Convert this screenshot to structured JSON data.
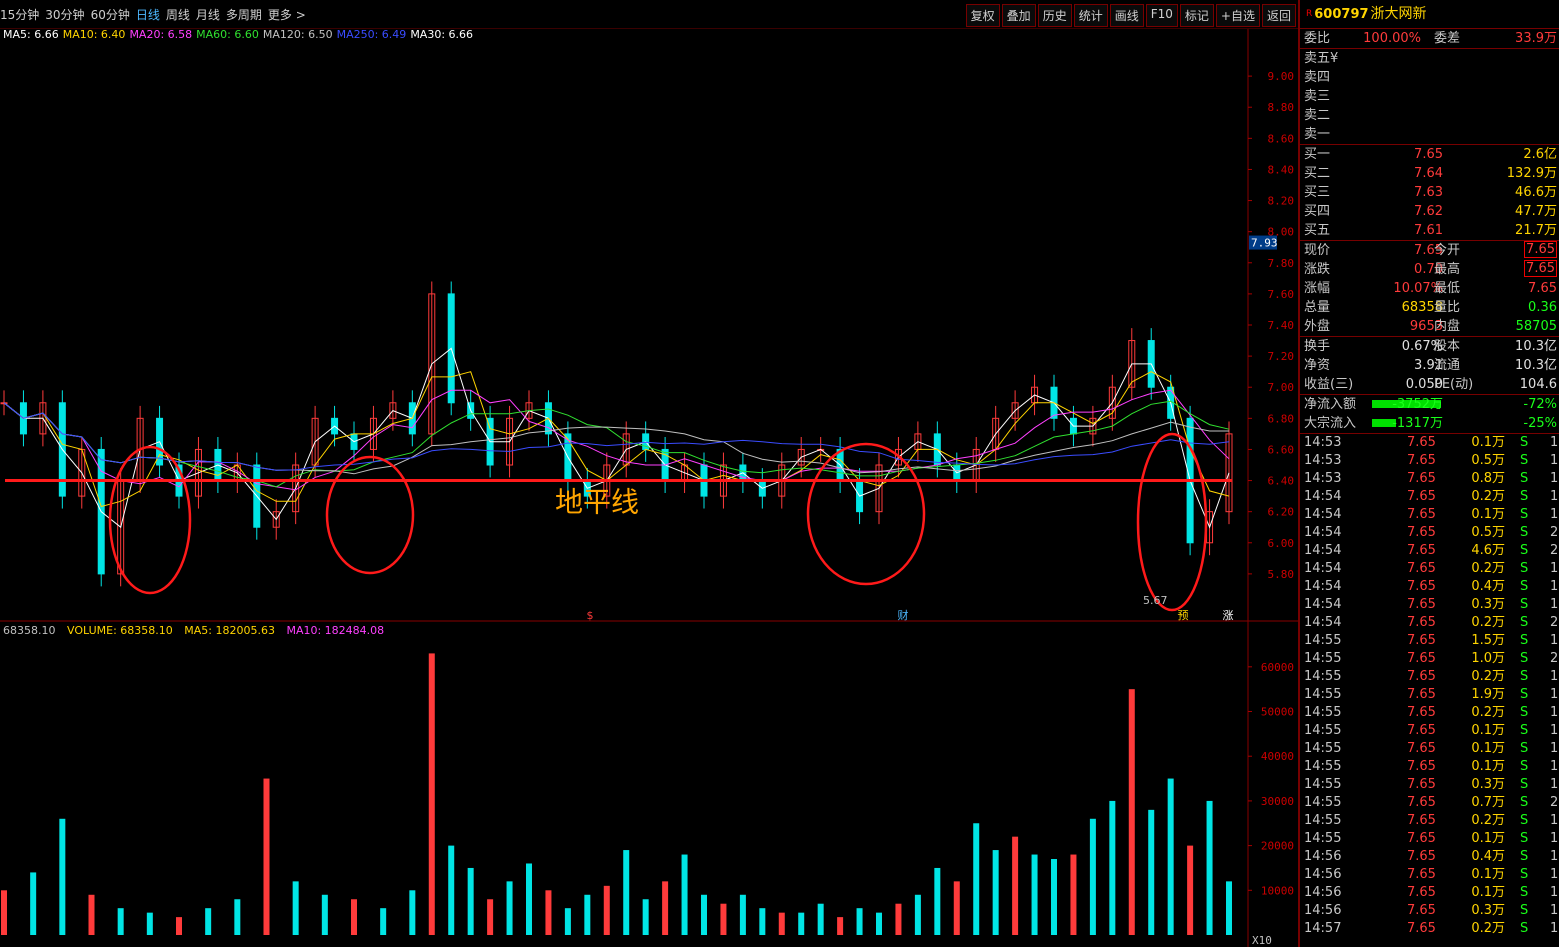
{
  "toolbar": {
    "periods": [
      "15分钟",
      "30分钟",
      "60分钟",
      "日线",
      "周线",
      "月线",
      "多周期",
      "更多"
    ],
    "active_period": "日线",
    "buttons": [
      "复权",
      "叠加",
      "历史",
      "统计",
      "画线",
      "F10",
      "标记",
      "+自选",
      "返回"
    ]
  },
  "ma_legend": [
    {
      "label": "MA5: 6.66",
      "color": "#ffffff"
    },
    {
      "label": "MA10: 6.40",
      "color": "#ffd400"
    },
    {
      "label": "MA20: 6.58",
      "color": "#ff40ff"
    },
    {
      "label": "MA60: 6.60",
      "color": "#30e030"
    },
    {
      "label": "MA120: 6.50",
      "color": "#c0c0c0"
    },
    {
      "label": "MA250: 6.49",
      "color": "#3a4cff"
    },
    {
      "label": "MA30: 6.66",
      "color": "#ffffff"
    }
  ],
  "vol_legend": {
    "left": "68358.10",
    "volume": "VOLUME: 68358.10",
    "ma5": "MA5: 182005.63",
    "ma10": "MA10: 182484.08"
  },
  "chart_data": {
    "type": "candlestick",
    "price_axis": {
      "ticks": [
        "9.00",
        "8.80",
        "8.60",
        "8.40",
        "8.20",
        "8.00",
        "7.80",
        "7.60",
        "7.40",
        "7.20",
        "7.00",
        "6.80",
        "6.60",
        "6.40",
        "6.20",
        "6.00",
        "5.80"
      ],
      "range": [
        5.6,
        9.2
      ]
    },
    "volume_axis": {
      "ticks": [
        "60000",
        "50000",
        "40000",
        "30000",
        "20000",
        "10000"
      ],
      "range": [
        0,
        66000
      ],
      "unit_label": "X10"
    },
    "current_price_tag": "7.93",
    "low_marker": "5.67",
    "horizon_label": "地平线",
    "horizon_price": 6.4,
    "event_markers": [
      "$",
      "财",
      "预",
      "涨"
    ],
    "price_polyline": [
      [
        0,
        6.9
      ],
      [
        10,
        6.7
      ],
      [
        20,
        6.9
      ],
      [
        30,
        6.3
      ],
      [
        40,
        6.6
      ],
      [
        50,
        5.8
      ],
      [
        60,
        6.4
      ],
      [
        70,
        6.8
      ],
      [
        80,
        6.5
      ],
      [
        90,
        6.3
      ],
      [
        100,
        6.6
      ],
      [
        110,
        6.4
      ],
      [
        120,
        6.5
      ],
      [
        130,
        6.1
      ],
      [
        140,
        6.2
      ],
      [
        150,
        6.5
      ],
      [
        160,
        6.8
      ],
      [
        170,
        6.7
      ],
      [
        180,
        6.6
      ],
      [
        190,
        6.8
      ],
      [
        200,
        6.9
      ],
      [
        210,
        6.7
      ],
      [
        220,
        7.6
      ],
      [
        230,
        6.9
      ],
      [
        240,
        6.8
      ],
      [
        250,
        6.5
      ],
      [
        260,
        6.8
      ],
      [
        270,
        6.9
      ],
      [
        280,
        6.7
      ],
      [
        290,
        6.4
      ],
      [
        300,
        6.3
      ],
      [
        310,
        6.5
      ],
      [
        320,
        6.7
      ],
      [
        330,
        6.6
      ],
      [
        340,
        6.4
      ],
      [
        350,
        6.5
      ],
      [
        360,
        6.3
      ],
      [
        370,
        6.5
      ],
      [
        380,
        6.4
      ],
      [
        390,
        6.3
      ],
      [
        400,
        6.5
      ],
      [
        410,
        6.6
      ],
      [
        420,
        6.6
      ],
      [
        430,
        6.4
      ],
      [
        440,
        6.2
      ],
      [
        450,
        6.5
      ],
      [
        460,
        6.6
      ],
      [
        470,
        6.7
      ],
      [
        480,
        6.5
      ],
      [
        490,
        6.4
      ],
      [
        500,
        6.6
      ],
      [
        510,
        6.8
      ],
      [
        520,
        6.9
      ],
      [
        530,
        7.0
      ],
      [
        540,
        6.8
      ],
      [
        550,
        6.7
      ],
      [
        560,
        6.8
      ],
      [
        570,
        7.0
      ],
      [
        580,
        7.3
      ],
      [
        590,
        7.0
      ],
      [
        600,
        6.8
      ],
      [
        610,
        6.0
      ],
      [
        620,
        6.2
      ],
      [
        630,
        6.7
      ]
    ],
    "volume_bars": [
      [
        0,
        10000
      ],
      [
        15,
        14000
      ],
      [
        30,
        26000
      ],
      [
        45,
        9000
      ],
      [
        60,
        6000
      ],
      [
        75,
        5000
      ],
      [
        90,
        4000
      ],
      [
        105,
        6000
      ],
      [
        120,
        8000
      ],
      [
        135,
        35000
      ],
      [
        150,
        12000
      ],
      [
        165,
        9000
      ],
      [
        180,
        8000
      ],
      [
        195,
        6000
      ],
      [
        210,
        10000
      ],
      [
        220,
        63000
      ],
      [
        230,
        20000
      ],
      [
        240,
        15000
      ],
      [
        250,
        8000
      ],
      [
        260,
        12000
      ],
      [
        270,
        16000
      ],
      [
        280,
        10000
      ],
      [
        290,
        6000
      ],
      [
        300,
        9000
      ],
      [
        310,
        11000
      ],
      [
        320,
        19000
      ],
      [
        330,
        8000
      ],
      [
        340,
        12000
      ],
      [
        350,
        18000
      ],
      [
        360,
        9000
      ],
      [
        370,
        7000
      ],
      [
        380,
        9000
      ],
      [
        390,
        6000
      ],
      [
        400,
        5000
      ],
      [
        410,
        5000
      ],
      [
        420,
        7000
      ],
      [
        430,
        4000
      ],
      [
        440,
        6000
      ],
      [
        450,
        5000
      ],
      [
        460,
        7000
      ],
      [
        470,
        9000
      ],
      [
        480,
        15000
      ],
      [
        490,
        12000
      ],
      [
        500,
        25000
      ],
      [
        510,
        19000
      ],
      [
        520,
        22000
      ],
      [
        530,
        18000
      ],
      [
        540,
        17000
      ],
      [
        550,
        18000
      ],
      [
        560,
        26000
      ],
      [
        570,
        30000
      ],
      [
        580,
        55000
      ],
      [
        590,
        28000
      ],
      [
        600,
        35000
      ],
      [
        610,
        20000
      ],
      [
        620,
        30000
      ],
      [
        630,
        12000
      ]
    ]
  },
  "panel": {
    "marker": "R",
    "code": "600797",
    "name": "浙大网新",
    "weibi_label": "委比",
    "weibi_value": "100.00%",
    "weicha_label": "委差",
    "weicha_value": "33.9万",
    "sells": [
      {
        "label": "卖五",
        "extra": "¥"
      },
      {
        "label": "卖四",
        "extra": ""
      },
      {
        "label": "卖三",
        "extra": ""
      },
      {
        "label": "卖二",
        "extra": ""
      },
      {
        "label": "卖一",
        "extra": ""
      }
    ],
    "buys": [
      {
        "label": "买一",
        "price": "7.65",
        "vol": "2.6亿"
      },
      {
        "label": "买二",
        "price": "7.64",
        "vol": "132.9万"
      },
      {
        "label": "买三",
        "price": "7.63",
        "vol": "46.6万"
      },
      {
        "label": "买四",
        "price": "7.62",
        "vol": "47.7万"
      },
      {
        "label": "买五",
        "price": "7.61",
        "vol": "21.7万"
      }
    ],
    "quote": [
      {
        "l": "现价",
        "v": "7.65",
        "m": "今开",
        "r": "7.65",
        "rbox": true
      },
      {
        "l": "涨跌",
        "v": "0.70",
        "m": "最高",
        "r": "7.65",
        "rbox": true
      },
      {
        "l": "涨幅",
        "v": "10.07%",
        "m": "最低",
        "r": "7.65"
      },
      {
        "l": "总量",
        "v": "68358",
        "m": "量比",
        "r": "0.36"
      },
      {
        "l": "外盘",
        "v": "9653",
        "m": "内盘",
        "r": "58705"
      }
    ],
    "fund": [
      {
        "l": "换手",
        "v": "0.67%",
        "m": "股本",
        "r": "10.3亿"
      },
      {
        "l": "净资",
        "v": "3.91",
        "m": "流通",
        "r": "10.3亿"
      },
      {
        "l": "收益(三)",
        "v": "0.050",
        "m": "PE(动)",
        "r": "104.6"
      }
    ],
    "flows": [
      {
        "l": "净流入额",
        "v": "-3752万",
        "p": "-72%",
        "bar": 0.72
      },
      {
        "l": "大宗流入",
        "v": "-1317万",
        "p": "-25%",
        "bar": 0.25
      }
    ],
    "trades": [
      {
        "t": "14:53",
        "p": "7.65",
        "v": "0.1万",
        "s": "S",
        "n": "1"
      },
      {
        "t": "14:53",
        "p": "7.65",
        "v": "0.5万",
        "s": "S",
        "n": "1"
      },
      {
        "t": "14:53",
        "p": "7.65",
        "v": "0.8万",
        "s": "S",
        "n": "1"
      },
      {
        "t": "14:54",
        "p": "7.65",
        "v": "0.2万",
        "s": "S",
        "n": "1"
      },
      {
        "t": "14:54",
        "p": "7.65",
        "v": "0.1万",
        "s": "S",
        "n": "1"
      },
      {
        "t": "14:54",
        "p": "7.65",
        "v": "0.5万",
        "s": "S",
        "n": "2"
      },
      {
        "t": "14:54",
        "p": "7.65",
        "v": "4.6万",
        "s": "S",
        "n": "2"
      },
      {
        "t": "14:54",
        "p": "7.65",
        "v": "0.2万",
        "s": "S",
        "n": "1"
      },
      {
        "t": "14:54",
        "p": "7.65",
        "v": "0.4万",
        "s": "S",
        "n": "1"
      },
      {
        "t": "14:54",
        "p": "7.65",
        "v": "0.3万",
        "s": "S",
        "n": "1"
      },
      {
        "t": "14:54",
        "p": "7.65",
        "v": "0.2万",
        "s": "S",
        "n": "2"
      },
      {
        "t": "14:55",
        "p": "7.65",
        "v": "1.5万",
        "s": "S",
        "n": "1"
      },
      {
        "t": "14:55",
        "p": "7.65",
        "v": "1.0万",
        "s": "S",
        "n": "2"
      },
      {
        "t": "14:55",
        "p": "7.65",
        "v": "0.2万",
        "s": "S",
        "n": "1"
      },
      {
        "t": "14:55",
        "p": "7.65",
        "v": "1.9万",
        "s": "S",
        "n": "1"
      },
      {
        "t": "14:55",
        "p": "7.65",
        "v": "0.2万",
        "s": "S",
        "n": "1"
      },
      {
        "t": "14:55",
        "p": "7.65",
        "v": "0.1万",
        "s": "S",
        "n": "1"
      },
      {
        "t": "14:55",
        "p": "7.65",
        "v": "0.1万",
        "s": "S",
        "n": "1"
      },
      {
        "t": "14:55",
        "p": "7.65",
        "v": "0.1万",
        "s": "S",
        "n": "1"
      },
      {
        "t": "14:55",
        "p": "7.65",
        "v": "0.3万",
        "s": "S",
        "n": "1"
      },
      {
        "t": "14:55",
        "p": "7.65",
        "v": "0.7万",
        "s": "S",
        "n": "2"
      },
      {
        "t": "14:55",
        "p": "7.65",
        "v": "0.2万",
        "s": "S",
        "n": "1"
      },
      {
        "t": "14:55",
        "p": "7.65",
        "v": "0.1万",
        "s": "S",
        "n": "1"
      },
      {
        "t": "14:56",
        "p": "7.65",
        "v": "0.4万",
        "s": "S",
        "n": "1"
      },
      {
        "t": "14:56",
        "p": "7.65",
        "v": "0.1万",
        "s": "S",
        "n": "1"
      },
      {
        "t": "14:56",
        "p": "7.65",
        "v": "0.1万",
        "s": "S",
        "n": "1"
      },
      {
        "t": "14:56",
        "p": "7.65",
        "v": "0.3万",
        "s": "S",
        "n": "1"
      },
      {
        "t": "14:57",
        "p": "7.65",
        "v": "0.2万",
        "s": "S",
        "n": "1"
      }
    ]
  }
}
